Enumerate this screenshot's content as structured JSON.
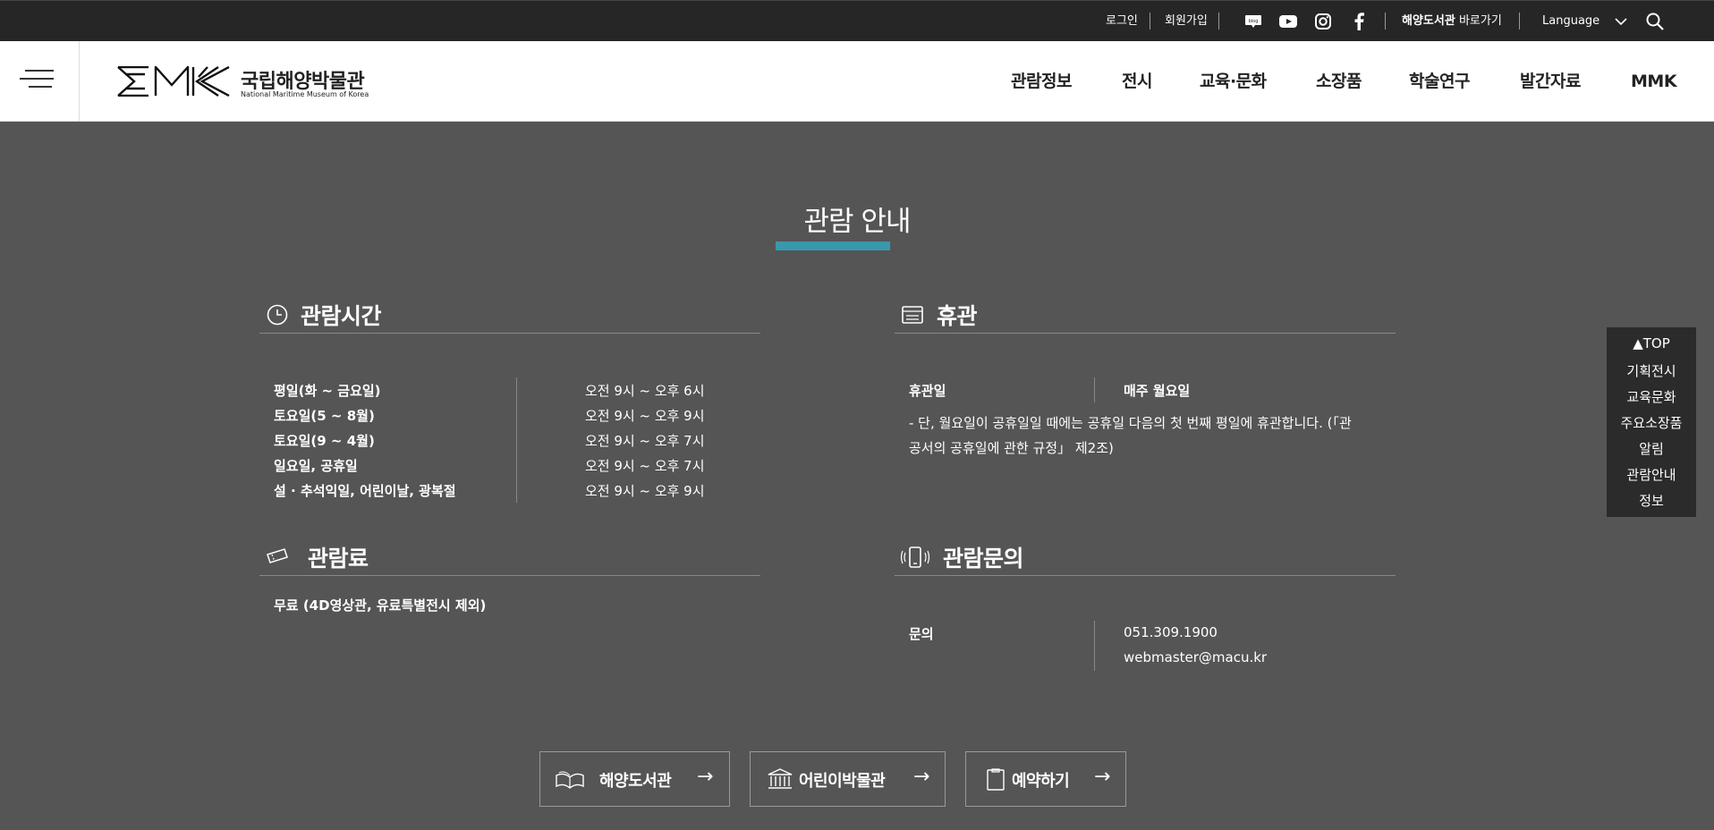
{
  "topbar": {
    "login": "로그인",
    "signup": "회원가입",
    "library_link_bold": "해양도서관",
    "library_link_rest": " 바로가기",
    "language": "Language"
  },
  "header": {
    "logo_kr": "국립해양박물관",
    "logo_en": "National Maritime Museum of Korea",
    "nav": [
      "관람정보",
      "전시",
      "교육·문화",
      "소장품",
      "학술연구",
      "발간자료",
      "MMK"
    ]
  },
  "main": {
    "title": "관람 안내",
    "hours": {
      "heading": "관람시간",
      "rows": [
        {
          "label": "평일(화 ~ 금요일)",
          "time": "오전 9시 ~ 오후 6시"
        },
        {
          "label": "토요일(5 ~ 8월)",
          "time": "오전 9시 ~ 오후 9시"
        },
        {
          "label": "토요일(9 ~ 4월)",
          "time": "오전 9시 ~ 오후 7시"
        },
        {
          "label": "일요일, 공휴일",
          "time": "오전 9시 ~ 오후 7시"
        },
        {
          "label": "설 · 추석익일, 어린이날, 광복절",
          "time": "오전 9시 ~ 오후 9시"
        }
      ]
    },
    "closed": {
      "heading": "휴관",
      "label": "휴관일",
      "value": "매주 월요일",
      "note_line1": "- 단, 월요일이 공휴일일 때에는 공휴일 다음의 첫 번째 평일에 휴관합니다. (「관",
      "note_line2": "공서의 공휴일에 관한 규정」 제2조)"
    },
    "fee": {
      "heading": "관람료",
      "text": "무료 (4D영상관, 유료특별전시 제외)"
    },
    "inquiry": {
      "heading": "관람문의",
      "label": "문의",
      "phone": "051.309.1900",
      "email": "webmaster@macu.kr"
    }
  },
  "quick_menu": {
    "items": [
      "▲TOP",
      "기획전시",
      "교육문화",
      "주요소장품",
      "알림",
      "관람안내",
      "정보"
    ]
  },
  "buttons": {
    "library": "해양도서관",
    "kids": "어린이박물관",
    "reserve": "예약하기",
    "arrow": "→"
  },
  "colors": {
    "accent": "#3a98ac",
    "page_bg": "#555555",
    "topbar_bg": "#262626"
  }
}
